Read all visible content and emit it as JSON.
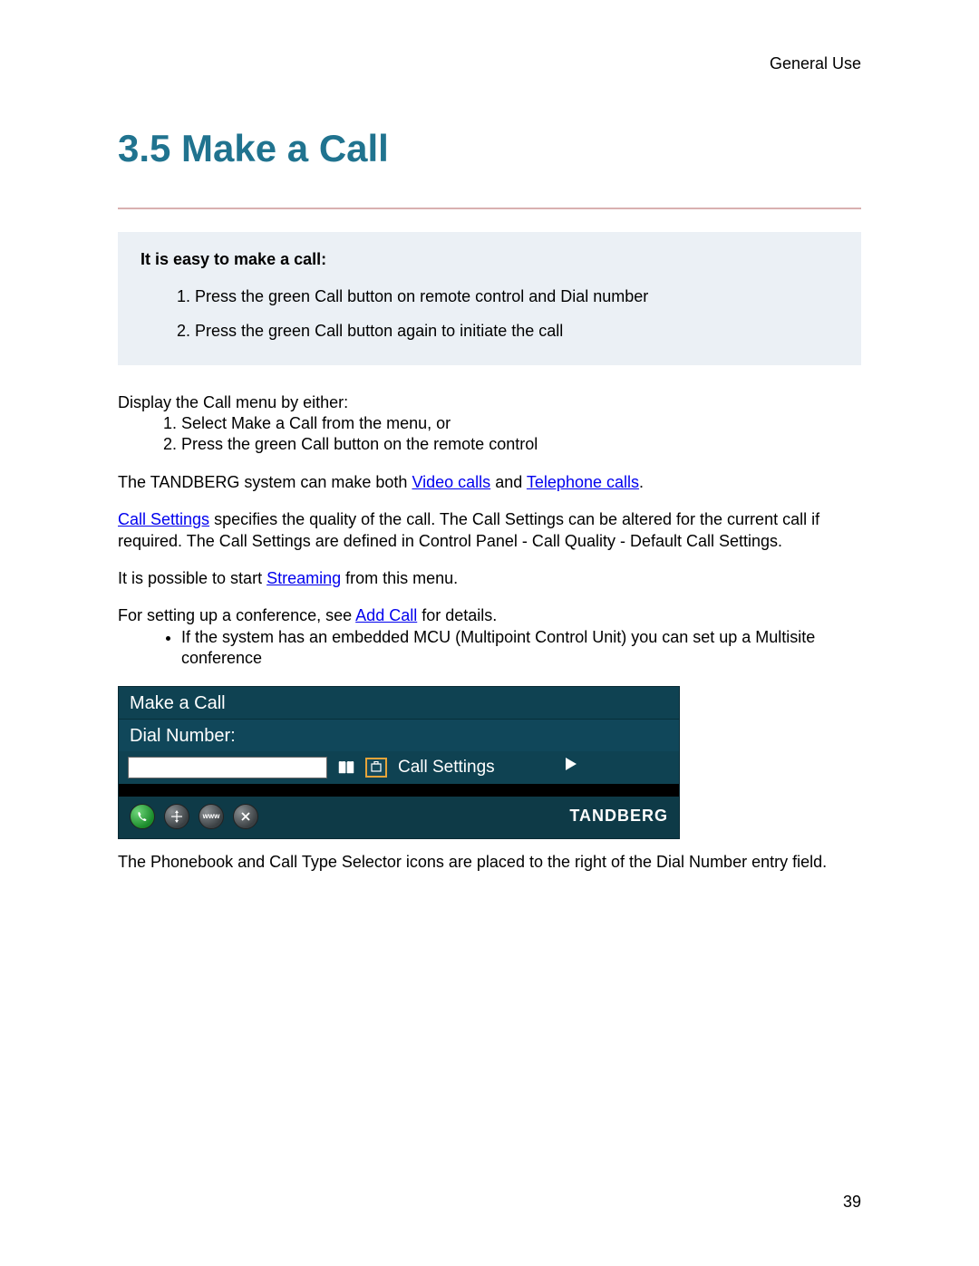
{
  "header": {
    "label": "General Use"
  },
  "section": {
    "title": "3.5 Make a Call"
  },
  "callout": {
    "title": "It is easy to make a call:",
    "steps": [
      "Press the green Call button on remote control and Dial number",
      "Press the green Call button again to initiate the call"
    ]
  },
  "body": {
    "display_menu_intro": "Display the Call menu by either:",
    "display_menu_items": [
      "Select Make a Call from the menu, or",
      "Press the green Call button on the remote control"
    ],
    "tandberg_pre": "The TANDBERG system can make both ",
    "link_video": "Video calls",
    "tandberg_mid": " and ",
    "link_phone": "Telephone calls",
    "tandberg_end": ".",
    "callsettings_link": "Call Settings",
    "callsettings_rest": " specifies the quality of the call. The Call Settings can be altered for the current call if required. The Call Settings are defined in Control Panel - Call Quality - Default Call Settings.",
    "stream_pre": "It is possible to start ",
    "stream_link": "Streaming",
    "stream_post": " from this menu.",
    "conf_pre": "For setting up a conference, see ",
    "conf_link": "Add Call",
    "conf_post": " for details.",
    "conf_bullet": "If the system has an embedded MCU (Multipoint Control Unit) you can set up a Multisite conference",
    "post_image": "The Phonebook and Call Type Selector icons are placed to the right of the Dial Number entry field."
  },
  "ui": {
    "title": "Make a Call",
    "dial_label": "Dial Number:",
    "call_settings": "Call Settings",
    "brand": "TANDBERG",
    "icons": {
      "phonebook": "phonebook-icon",
      "calltype": "calltype-icon",
      "arrow": "arrow-right-icon",
      "call": "call-icon",
      "nav": "nav-icon",
      "www": "www-icon",
      "close": "close-icon"
    }
  },
  "footer": {
    "page": "39"
  }
}
